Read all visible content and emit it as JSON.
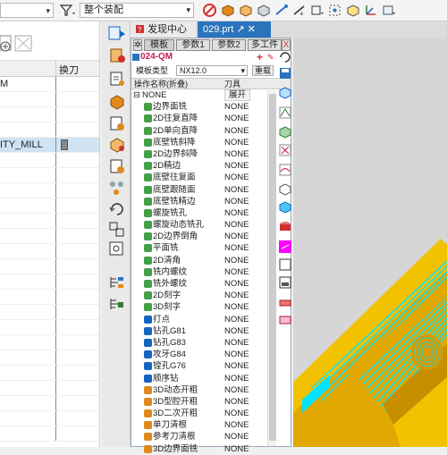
{
  "toolbar": {
    "assembly_combo": "整个装配",
    "colors": {
      "stop": "#d32f2f",
      "orange": "#e08a1e"
    }
  },
  "left_panel": {
    "column_header": "换刀",
    "rows": [
      {
        "label": "M",
        "selected": false
      },
      {
        "label": "",
        "selected": false
      },
      {
        "label": "",
        "selected": false
      },
      {
        "label": "",
        "selected": false
      },
      {
        "label": "ITY_MILL",
        "selected": true
      },
      {
        "label": "",
        "selected": false
      },
      {
        "label": "",
        "selected": false
      },
      {
        "label": "",
        "selected": false
      },
      {
        "label": "",
        "selected": false
      },
      {
        "label": "",
        "selected": false
      },
      {
        "label": "",
        "selected": false
      },
      {
        "label": "",
        "selected": false
      },
      {
        "label": "",
        "selected": false
      },
      {
        "label": "",
        "selected": false
      },
      {
        "label": "",
        "selected": false
      },
      {
        "label": "",
        "selected": false
      },
      {
        "label": "",
        "selected": false
      },
      {
        "label": "",
        "selected": false
      },
      {
        "label": "",
        "selected": false
      },
      {
        "label": "",
        "selected": false
      },
      {
        "label": "",
        "selected": false
      },
      {
        "label": "",
        "selected": false
      },
      {
        "label": "",
        "selected": false
      },
      {
        "label": "",
        "selected": false
      }
    ]
  },
  "tabs": {
    "discover": "发现中心",
    "file": "029.prt"
  },
  "op_panel": {
    "tabs": [
      "模板",
      "参数1",
      "参数2",
      "多工件"
    ],
    "close": "X",
    "title": "024-QM",
    "type_label": "模板类型",
    "type_value": "NX12.0",
    "reload_button": "重载",
    "col_name": "操作名称(折叠)",
    "col_tool": "刀具",
    "root_name": "NONE",
    "root_action": "展开",
    "operations": [
      {
        "name": "边界面铣",
        "tool": "NONE"
      },
      {
        "name": "2D往复直降",
        "tool": "NONE"
      },
      {
        "name": "2D单向直降",
        "tool": "NONE"
      },
      {
        "name": "底壁铣斜降",
        "tool": "NONE"
      },
      {
        "name": "2D边界斜降",
        "tool": "NONE"
      },
      {
        "name": "2D精边",
        "tool": "NONE"
      },
      {
        "name": "底壁往复面",
        "tool": "NONE"
      },
      {
        "name": "底壁跟随面",
        "tool": "NONE"
      },
      {
        "name": "底壁铣精边",
        "tool": "NONE"
      },
      {
        "name": "螺旋铣孔",
        "tool": "NONE"
      },
      {
        "name": "螺旋动态铣孔",
        "tool": "NONE"
      },
      {
        "name": "2D边界倒角",
        "tool": "NONE"
      },
      {
        "name": "平面铣",
        "tool": "NONE"
      },
      {
        "name": "2D清角",
        "tool": "NONE"
      },
      {
        "name": "铣内螺纹",
        "tool": "NONE"
      },
      {
        "name": "铣外螺纹",
        "tool": "NONE"
      },
      {
        "name": "2D刻字",
        "tool": "NONE"
      },
      {
        "name": "3D刻字",
        "tool": "NONE"
      },
      {
        "name": "打点",
        "tool": "NONE"
      },
      {
        "name": "钻孔G81",
        "tool": "NONE"
      },
      {
        "name": "钻孔G83",
        "tool": "NONE"
      },
      {
        "name": "攻牙G84",
        "tool": "NONE"
      },
      {
        "name": "镗孔G76",
        "tool": "NONE"
      },
      {
        "name": "顺序钻",
        "tool": "NONE"
      },
      {
        "name": "3D动态开粗",
        "tool": "NONE"
      },
      {
        "name": "3D型腔开粗",
        "tool": "NONE"
      },
      {
        "name": "3D二次开粗",
        "tool": "NONE"
      },
      {
        "name": "单刀清根",
        "tool": "NONE"
      },
      {
        "name": "参考刀清根",
        "tool": "NONE"
      },
      {
        "name": "3D边界面铣",
        "tool": "NONE"
      }
    ]
  },
  "viewport": {
    "colors": {
      "body": "#e0a800",
      "toolpath": "#00e5ff",
      "background": "#d6d6d6"
    }
  }
}
